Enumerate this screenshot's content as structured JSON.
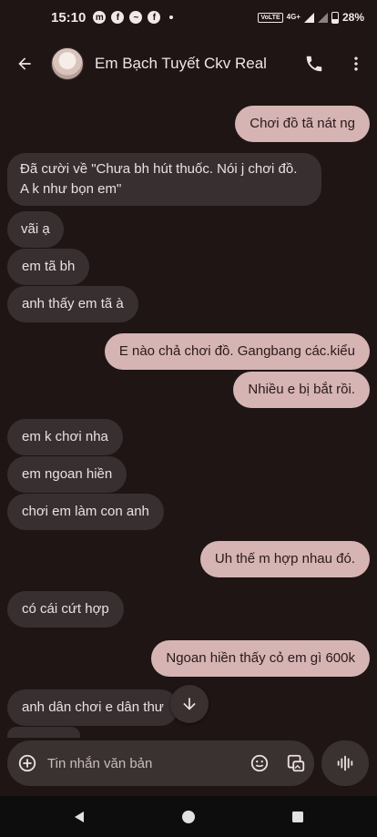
{
  "status_bar": {
    "time": "15:10",
    "network": "4G+",
    "battery": "28%",
    "notifications": [
      "messenger-icon",
      "facebook-icon",
      "messenger-icon",
      "facebook-icon"
    ]
  },
  "header": {
    "contact_name": "Em Bạch Tuyết Ckv Real",
    "back_icon": "arrow-back-icon",
    "call_icon": "phone-icon",
    "menu_icon": "more-vert-icon"
  },
  "messages": [
    {
      "direction": "out",
      "text": "Chơi đồ tã nát ng"
    },
    {
      "direction": "in",
      "lines": [
        "Đã cười về \"Chưa bh hút thuốc. Nói j chơi đồ.",
        "A k như bọn em\""
      ]
    },
    {
      "direction": "in",
      "text": "vãi ạ"
    },
    {
      "direction": "in",
      "text": "em tã bh"
    },
    {
      "direction": "in",
      "text": "anh thấy em tã à"
    },
    {
      "direction": "out",
      "text": "E nào chả chơi đồ. Gangbang các.kiểu"
    },
    {
      "direction": "out",
      "text": "Nhiều e bị bắt rồi."
    },
    {
      "direction": "in",
      "text": "em k chơi nha"
    },
    {
      "direction": "in",
      "text": "em ngoan hiền"
    },
    {
      "direction": "in",
      "text": "chơi em làm con anh"
    },
    {
      "direction": "out",
      "text": "Uh thế m hợp nhau đó."
    },
    {
      "direction": "in",
      "text": "có cái cứt hợp"
    },
    {
      "direction": "out",
      "text": "Ngoan hiền thấy cỏ em gì 600k"
    },
    {
      "direction": "in",
      "text": "anh dân chơi e dân thư"
    }
  ],
  "composer": {
    "placeholder": "Tin nhắn văn bản",
    "add_icon": "add-circle-icon",
    "emoji_icon": "emoji-icon",
    "gallery_icon": "gallery-icon",
    "voice_icon": "voice-icon"
  },
  "nav_bar": {
    "back_icon": "nav-back-icon",
    "home_icon": "nav-home-icon",
    "recents_icon": "nav-recents-icon"
  }
}
